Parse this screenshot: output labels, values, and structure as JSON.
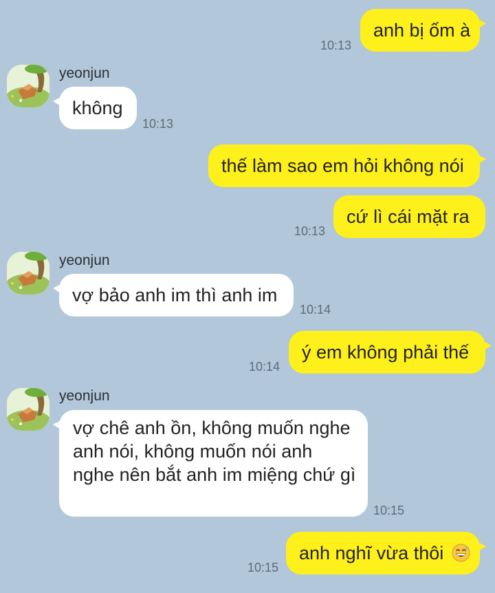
{
  "contact": {
    "name": "yeonjun",
    "avatar_icon": "tree-stump-scene-icon"
  },
  "colors": {
    "background": "#b2c7d9",
    "my_bubble": "#fef01b",
    "their_bubble": "#ffffff"
  },
  "messages": [
    {
      "from": "me",
      "text": "anh bị ốm à",
      "time": "10:13"
    },
    {
      "from": "them",
      "sender": "yeonjun",
      "text": "không",
      "time": "10:13"
    },
    {
      "from": "me",
      "text": "thế làm sao em hỏi không nói",
      "time": ""
    },
    {
      "from": "me",
      "text": "cứ lì cái mặt ra",
      "time": "10:13"
    },
    {
      "from": "them",
      "sender": "yeonjun",
      "text": "vợ bảo anh im thì anh im",
      "time": "10:14"
    },
    {
      "from": "me",
      "text": "ý em không phải thế",
      "time": "10:14"
    },
    {
      "from": "them",
      "sender": "yeonjun",
      "text": "vợ chê anh ồn, không muốn nghe anh nói, không muốn nói anh nghe nên bắt anh im miệng chứ gì",
      "time": "10:15"
    },
    {
      "from": "me",
      "text": "anh nghĩ vừa thôi",
      "emoji": "grinning-sweat-emoji",
      "time": "10:15"
    }
  ]
}
